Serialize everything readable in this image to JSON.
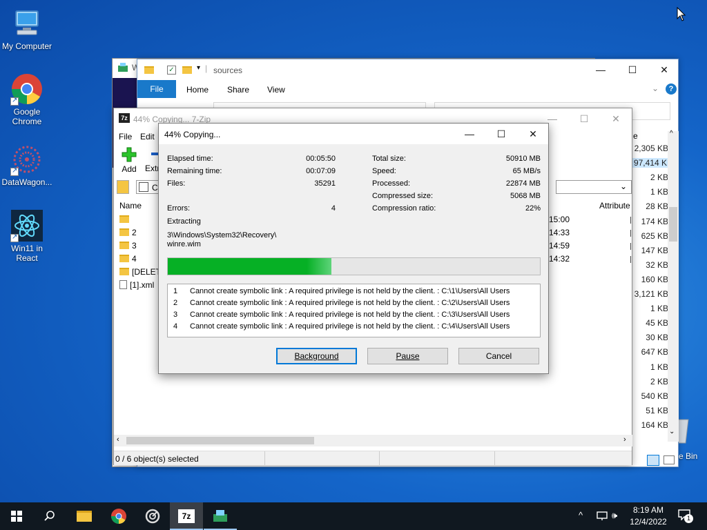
{
  "desktop": {
    "icons": [
      {
        "label": "My Computer"
      },
      {
        "label": "Google Chrome"
      },
      {
        "label": "DataWagon..."
      },
      {
        "label": "Win11 in React"
      }
    ],
    "recycle_partial": "e Bin"
  },
  "explorer": {
    "title_partial": "W",
    "path": "sources",
    "ribbon_tabs": [
      "File",
      "Home",
      "Share",
      "View"
    ],
    "sizes": [
      "2,305 KB",
      "97,414 KB",
      "2 KB",
      "1 KB",
      "28 KB",
      "174 KB",
      "625 KB",
      "147 KB",
      "32 KB",
      "160 KB",
      "3,121 KB",
      "1 KB",
      "45 KB",
      "30 KB",
      "647 KB",
      "1 KB",
      "2 KB",
      "540 KB",
      "51 KB",
      "164 KB"
    ],
    "col_partial": "e"
  },
  "zip": {
    "title": "44% Copying... 7-Zip",
    "menu": [
      "File",
      "Edit"
    ],
    "toolbar": {
      "add": "Add",
      "extract_partial": "Extr"
    },
    "address_partial": "C",
    "columns": {
      "name": "Name",
      "attributes": "Attribute"
    },
    "rows": [
      {
        "name": "",
        "time": "15:00"
      },
      {
        "name": "2",
        "time": "14:33"
      },
      {
        "name": "3",
        "time": "14:59"
      },
      {
        "name": "4",
        "time": "14:32"
      },
      {
        "name": "[DELETE",
        "time": ""
      },
      {
        "name": "[1].xml",
        "time": ""
      }
    ],
    "status": "0 / 6 object(s) selected"
  },
  "dialog": {
    "title": "44% Copying...",
    "elapsed_label": "Elapsed time:",
    "elapsed": "00:05:50",
    "remaining_label": "Remaining time:",
    "remaining": "00:07:09",
    "files_label": "Files:",
    "files": "35291",
    "errors_label": "Errors:",
    "errors": "4",
    "total_label": "Total size:",
    "total": "50910 MB",
    "speed_label": "Speed:",
    "speed": "65 MB/s",
    "processed_label": "Processed:",
    "processed": "22874 MB",
    "compressed_label": "Compressed size:",
    "compressed": "5068 MB",
    "ratio_label": "Compression ratio:",
    "ratio": "22%",
    "action": "Extracting",
    "current_path": "3\\Windows\\System32\\Recovery\\",
    "current_file": "winre.wim",
    "progress": 0.44,
    "log": [
      {
        "n": "1",
        "msg": "Cannot create symbolic link : A required privilege is not held by the client. : C:\\1\\Users\\All Users"
      },
      {
        "n": "2",
        "msg": "Cannot create symbolic link : A required privilege is not held by the client. : C:\\2\\Users\\All Users"
      },
      {
        "n": "3",
        "msg": "Cannot create symbolic link : A required privilege is not held by the client. : C:\\3\\Users\\All Users"
      },
      {
        "n": "4",
        "msg": "Cannot create symbolic link : A required privilege is not held by the client. : C:\\4\\Users\\All Users"
      }
    ],
    "buttons": {
      "background": "Background",
      "pause": "Pause",
      "cancel": "Cancel"
    }
  },
  "taskbar": {
    "time": "8:19 AM",
    "date": "12/4/2022",
    "notif_count": "1"
  },
  "colors": {
    "accent": "#0078d7",
    "progress": "#06b025",
    "taskbar": "#101820"
  }
}
